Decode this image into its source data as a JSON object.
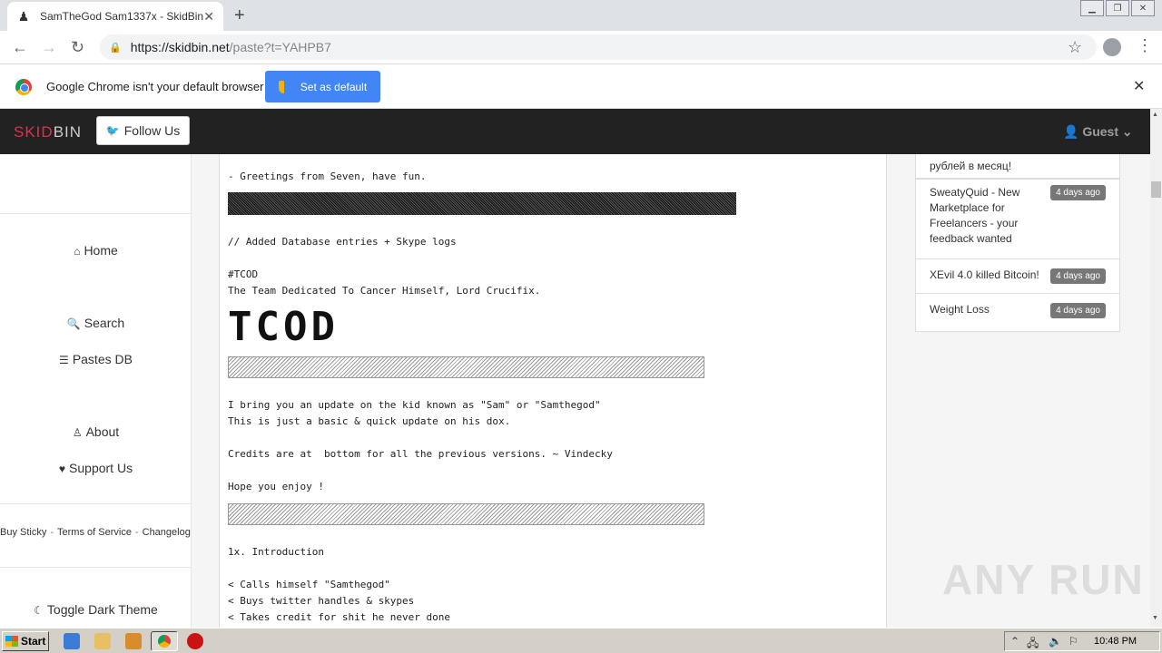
{
  "browser": {
    "tab_title": "SamTheGod Sam1337x - SkidBin",
    "url_host": "https://skidbin.net",
    "url_path": "/paste?t=YAHPB7",
    "infobar_text": "Google Chrome isn't your default browser",
    "set_default_label": "Set as default"
  },
  "site": {
    "brand_skid": "SKID",
    "brand_bin": "BIN",
    "follow_label": "Follow Us",
    "guest_label": "Guest"
  },
  "sidebar": {
    "home": "Home",
    "search": "Search",
    "pastes_db": "Pastes DB",
    "about": "About",
    "support": "Support Us",
    "footer_sticky": "Buy Sticky",
    "footer_tos": "Terms of Service",
    "footer_changelog": "Changelog",
    "dark_theme": "Toggle Dark Theme"
  },
  "paste": {
    "greetings": "- Greetings from Seven, have fun.",
    "added": "// Added Database entries + Skype logs",
    "tcod_tag": "#TCOD",
    "tcod_desc": "The Team Dedicated To Cancer Himself, Lord Crucifix.",
    "tcod_art": "TCOD",
    "update1": "I bring you an update on the kid known as \"Sam\" or \"Samthegod\"",
    "update2": "This is just a basic & quick update on his dox.",
    "credits": "Credits are at  bottom for all the previous versions. ~ Vindecky",
    "enjoy": "Hope you enjoy !",
    "intro": "1x. Introduction",
    "bullet1": "< Calls himself \"Samthegod\"",
    "bullet2": "< Buys twitter handles & skypes",
    "bullet3": "< Takes credit for shit he never done"
  },
  "recent": {
    "partial": "рублей в месяц!",
    "item1": "SweatyQuid - New Marketplace for Freelancers - your feedback wanted",
    "item1_age": "4 days ago",
    "item2": "XEvil 4.0 killed Bitcoin!",
    "item2_age": "4 days ago",
    "item3": "Weight Loss",
    "item3_age": "4 days ago"
  },
  "watermark": "ANY RUN",
  "taskbar": {
    "start": "Start",
    "clock": "10:48 PM"
  },
  "colors": {
    "brand_red": "#e0304a",
    "navbar_bg": "#222222",
    "chrome_blue": "#4285f4",
    "badge_gray": "#777777"
  }
}
